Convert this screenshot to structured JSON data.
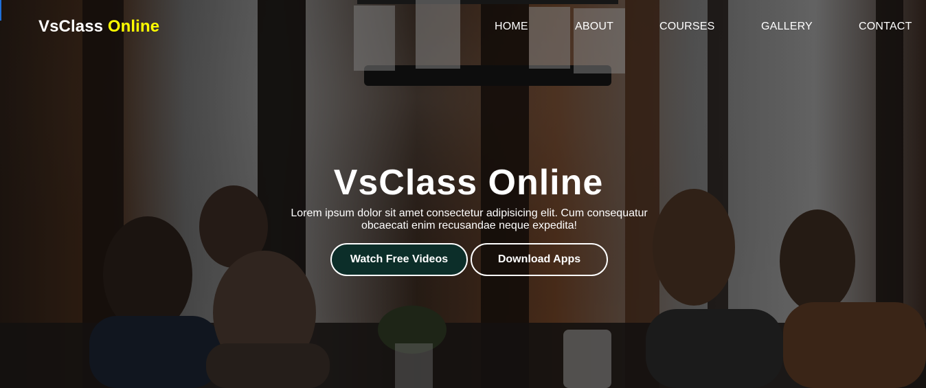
{
  "brand": {
    "name_main": "VsClass",
    "name_accent": "Online",
    "accent_color": "#ffff00"
  },
  "nav": {
    "items": [
      {
        "label": "HOME"
      },
      {
        "label": "ABOUT"
      },
      {
        "label": "COURSES"
      },
      {
        "label": "GALLERY"
      },
      {
        "label": "CONTACT"
      }
    ]
  },
  "hero": {
    "title": "VsClass Online",
    "description": "Lorem ipsum dolor sit amet consectetur adipisicing elit. Cum consequatur obcaecati enim recusandae neque expedita!",
    "primary_button": "Watch Free Videos",
    "secondary_button": "Download Apps",
    "primary_button_color": "#0c2e29"
  }
}
